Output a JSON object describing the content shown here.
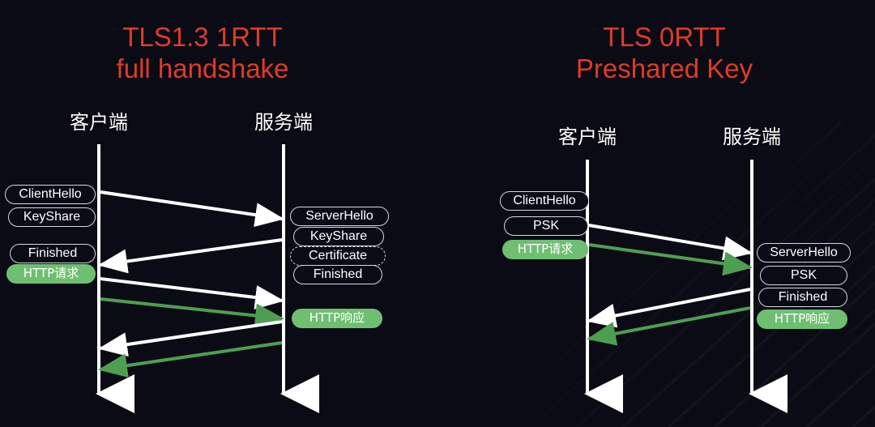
{
  "page": {
    "background_color": "#0b0b16",
    "title_color": "#e03b28",
    "line_color": "#ffffff",
    "green_color": "#6fbf73"
  },
  "diagrams": [
    {
      "id": "tls13-1rtt-full-handshake",
      "title": "TLS1.3 1RTT\nfull handshake",
      "actors": {
        "client": "客户端",
        "server": "服务端"
      },
      "client_messages": [
        {
          "label": "ClientHello",
          "style": "outline"
        },
        {
          "label": "KeyShare",
          "style": "outline"
        },
        {
          "label": "Finished",
          "style": "outline"
        },
        {
          "label": "HTTP请求",
          "style": "green"
        }
      ],
      "server_messages": [
        {
          "label": "ServerHello",
          "style": "outline"
        },
        {
          "label": "KeyShare",
          "style": "outline"
        },
        {
          "label": "Certificate",
          "style": "outline-dashed"
        },
        {
          "label": "Finished",
          "style": "outline"
        },
        {
          "label": "HTTP响应",
          "style": "green"
        }
      ],
      "arrows": [
        {
          "direction": "client-to-server",
          "color": "white"
        },
        {
          "direction": "server-to-client",
          "color": "white"
        },
        {
          "direction": "client-to-server",
          "color": "white"
        },
        {
          "direction": "client-to-server",
          "color": "green"
        },
        {
          "direction": "server-to-client",
          "color": "white"
        },
        {
          "direction": "server-to-client",
          "color": "green"
        }
      ]
    },
    {
      "id": "tls-0rtt-preshared-key",
      "title": "TLS 0RTT\nPreshared Key",
      "actors": {
        "client": "客户端",
        "server": "服务端"
      },
      "client_messages": [
        {
          "label": "ClientHello",
          "style": "outline"
        },
        {
          "label": "PSK",
          "style": "outline"
        },
        {
          "label": "HTTP请求",
          "style": "green"
        }
      ],
      "server_messages": [
        {
          "label": "ServerHello",
          "style": "outline"
        },
        {
          "label": "PSK",
          "style": "outline"
        },
        {
          "label": "Finished",
          "style": "outline"
        },
        {
          "label": "HTTP响应",
          "style": "green"
        }
      ],
      "arrows": [
        {
          "direction": "client-to-server",
          "color": "white"
        },
        {
          "direction": "client-to-server",
          "color": "green"
        },
        {
          "direction": "server-to-client",
          "color": "white"
        },
        {
          "direction": "server-to-client",
          "color": "green"
        }
      ]
    }
  ]
}
